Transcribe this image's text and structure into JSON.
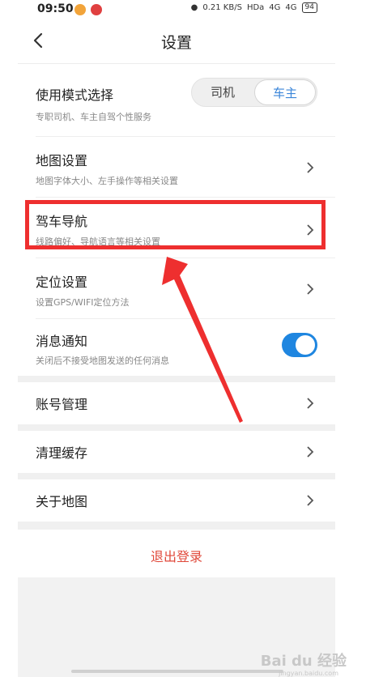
{
  "status_bar": {
    "time": "09:50",
    "net_speed": "0.21",
    "net_unit": "KB/S",
    "hd": "HDa",
    "signal1": "4G",
    "signal2": "4G",
    "battery": "94"
  },
  "header": {
    "title": "设置"
  },
  "mode": {
    "title": "使用模式选择",
    "subtitle": "专职司机、车主自驾个性服务",
    "option_driver": "司机",
    "option_owner": "车主",
    "selected": "车主"
  },
  "map_settings": {
    "title": "地图设置",
    "subtitle": "地图字体大小、左手操作等相关设置"
  },
  "navigation": {
    "title": "驾车导航",
    "subtitle": "线路偏好、导航语言等相关设置"
  },
  "location": {
    "title": "定位设置",
    "subtitle": "设置GPS/WIFI定位方法"
  },
  "notification": {
    "title": "消息通知",
    "subtitle": "关闭后不接受地图发送的任何消息",
    "enabled": true
  },
  "account": {
    "title": "账号管理"
  },
  "cache": {
    "title": "清理缓存"
  },
  "about": {
    "title": "关于地图"
  },
  "logout": {
    "label": "退出登录"
  },
  "colors": {
    "accent_blue": "#1f86e0",
    "logout_red": "#e0493b",
    "highlight_red": "#ee2f2f"
  },
  "watermark": {
    "text": "Bai du 经验",
    "sub": "jingyan.baidu.com"
  }
}
